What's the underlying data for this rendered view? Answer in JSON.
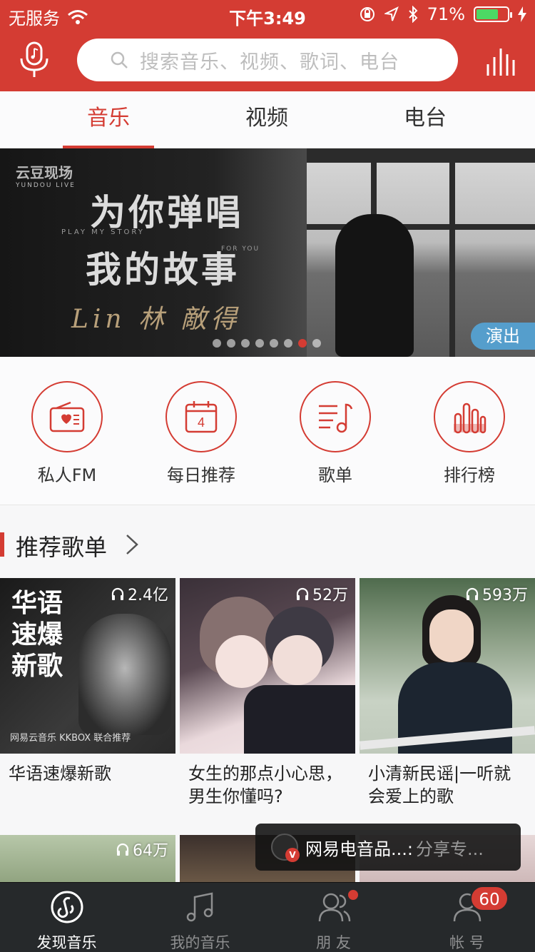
{
  "status_bar": {
    "carrier": "无服务",
    "time": "下午3:49",
    "battery": "71%",
    "battery_level": 0.71
  },
  "search": {
    "placeholder": "搜索音乐、视频、歌词、电台"
  },
  "tabs": [
    {
      "label": "音乐",
      "active": true
    },
    {
      "label": "视频",
      "active": false
    },
    {
      "label": "电台",
      "active": false
    }
  ],
  "banner": {
    "logo": "云豆现场",
    "logo_sub": "YUNDOU LIVE",
    "title_line1": "为你弹唱",
    "title_line2": "我的故事",
    "tagline1": "PLAY MY STORY",
    "tagline2": "FOR YOU",
    "artist": "Lin 林 敵得",
    "badge": "演出",
    "dot_count": 8,
    "active_dot": 7
  },
  "entries": [
    {
      "label": "私人FM",
      "icon": "radio-heart-icon"
    },
    {
      "label": "每日推荐",
      "icon": "calendar-icon",
      "day": "4"
    },
    {
      "label": "歌单",
      "icon": "playlist-note-icon"
    },
    {
      "label": "排行榜",
      "icon": "chart-bars-icon"
    }
  ],
  "section": {
    "title": "推荐歌单"
  },
  "playlists": [
    {
      "plays": "2.4亿",
      "name": "华语速爆新歌",
      "cover_text": "华语\n速爆\n新歌",
      "cover_foot": "网易云音乐 KKBOX 联合推荐"
    },
    {
      "plays": "52万",
      "name": "女生的那点小心思，男生你懂吗?"
    },
    {
      "plays": "593万",
      "name": "小清新民谣|一听就会爱上的歌"
    }
  ],
  "playlists_row2": [
    {
      "plays": "64万"
    },
    {
      "plays": ""
    },
    {
      "plays": ""
    }
  ],
  "toast": {
    "title": "网易电音品...:",
    "subtitle": "分享专...",
    "logo_badge": "V"
  },
  "bottom_nav": [
    {
      "label": "发现音乐",
      "active": true
    },
    {
      "label": "我的音乐",
      "active": false
    },
    {
      "label": "朋 友",
      "active": false,
      "dot": true
    },
    {
      "label": "帐 号",
      "active": false,
      "badge": "60"
    }
  ],
  "colors": {
    "accent": "#d43c33",
    "nav_bg": "#26292b"
  }
}
